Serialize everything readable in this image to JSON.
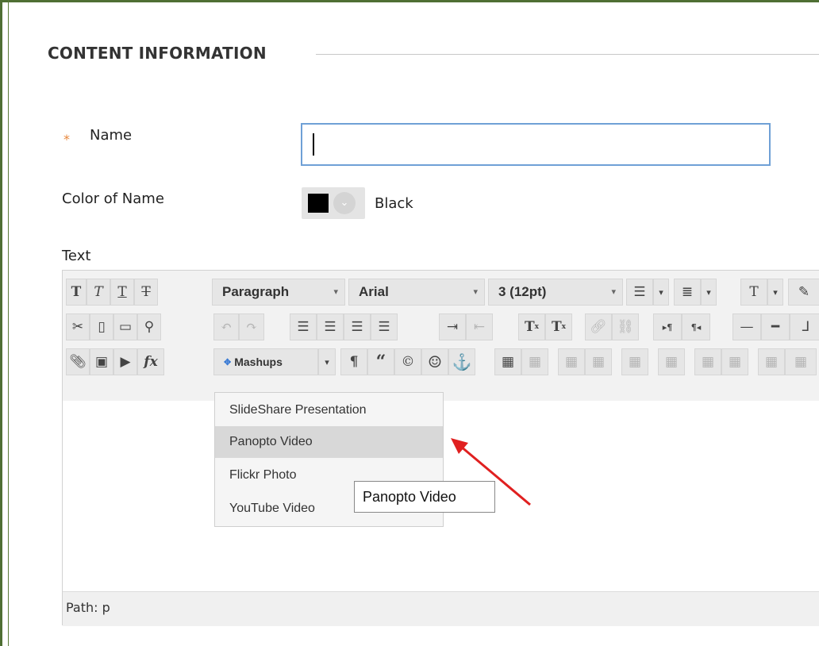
{
  "section": {
    "title": "CONTENT INFORMATION"
  },
  "form": {
    "name_label": "Name",
    "required_star": "*",
    "name_value": "",
    "color_label": "Color of Name",
    "color_value": "Black",
    "color_swatch": "#000000",
    "text_label": "Text"
  },
  "toolbar": {
    "row1": {
      "bold": "T",
      "italic": "T",
      "underline": "T",
      "strike": "T",
      "format_select": "Paragraph",
      "font_select": "Arial",
      "size_select": "3 (12pt)",
      "text_color": "T"
    },
    "row2": {
      "superscript": "T",
      "subscript": "T",
      "ltr_mark": "▸¶",
      "rtl_mark": "¶◂"
    },
    "row3": {
      "formula": "fx",
      "mashups": "Mashups",
      "paragraph": "¶",
      "quote": "“",
      "copyright": "©",
      "anchor": "⚓"
    }
  },
  "mashups_menu": {
    "items": [
      "SlideShare Presentation",
      "Panopto Video",
      "Flickr Photo",
      "YouTube Video"
    ],
    "hovered": "Panopto Video"
  },
  "tooltip": {
    "text": "Panopto Video"
  },
  "status": {
    "path_label": "Path:",
    "path_value": "p"
  },
  "colors": {
    "frame": "#4f6f34",
    "required": "#e8873c",
    "input_focus": "#6fa0d6",
    "annotation_arrow": "#e02020"
  }
}
